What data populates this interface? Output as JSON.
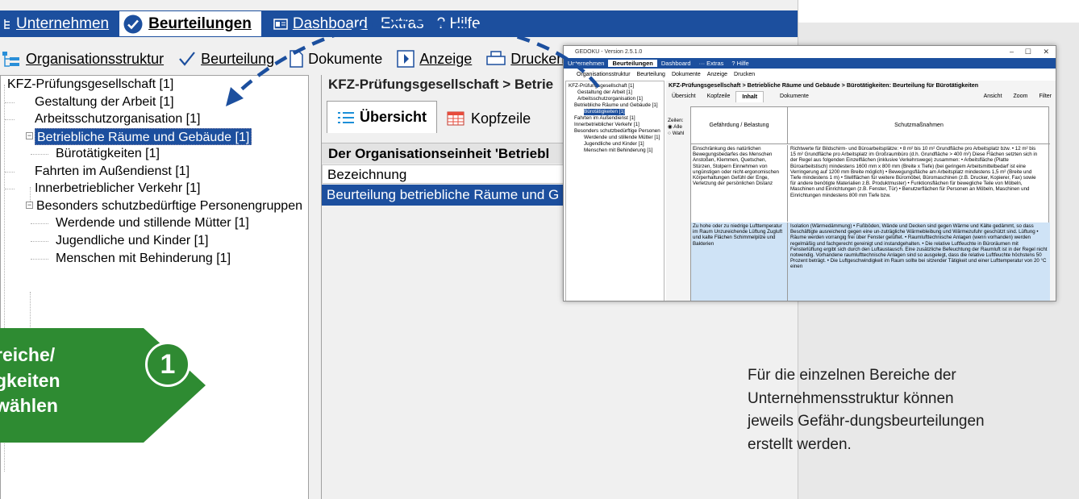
{
  "menubar": {
    "items": [
      {
        "label": "Unternehmen",
        "active": false
      },
      {
        "label": "Beurteilungen",
        "active": true
      },
      {
        "label": "Dashboard",
        "active": false
      },
      {
        "label": "Extras",
        "active": false
      },
      {
        "label": "? Hilfe",
        "active": false
      }
    ]
  },
  "toolbar": {
    "items": [
      "Organisationsstruktur",
      "Beurteilung",
      "Dokumente",
      "Anzeige",
      "Drucken"
    ]
  },
  "tree": {
    "root": "KFZ-Prüfungsgesellschaft [1]",
    "items": [
      "Gestaltung der Arbeit [1]",
      "Arbeitsschutzorganisation [1]",
      "Betriebliche Räume und Gebäude [1]",
      "Bürotätigkeiten [1]",
      "Fahrten im Außendienst [1]",
      "Innerbetrieblicher Verkehr [1]",
      "Besonders schutzbedürftige Personengruppen",
      "Werdende und stillende Mütter [1]",
      "Jugendliche und Kinder [1]",
      "Menschen mit Behinderung [1]"
    ]
  },
  "content": {
    "breadcrumb": "KFZ-Prüfungsgesellschaft > Betrie",
    "tabs": [
      "Übersicht",
      "Kopfzeile"
    ],
    "section_heading": "Der Organisationseinheit 'Betriebl",
    "column_header": "Bezeichnung",
    "row": "Beurteilung betriebliche Räume und G"
  },
  "callout": {
    "lines": [
      "reiche/",
      "gkeiten",
      "wählen"
    ],
    "step": "1",
    "color": "#2e8b32"
  },
  "info_text": "Für die einzelnen Bereiche der Unternehmensstruktur können jeweils Gefähr-dungsbeurteilungen erstellt werden.",
  "screenshot": {
    "title": "GEDOKU - Version 2.5.1.0",
    "menubar": [
      "Unternehmen",
      "Beurteilungen",
      "Dashboard",
      "··· Extras",
      "? Hilfe"
    ],
    "toolbar": [
      "Organisationsstruktur",
      "Beurteilung",
      "Dokumente",
      "Anzeige",
      "Drucken"
    ],
    "tree": [
      "KFZ-Prüfungsgesellschaft [1]",
      "Gestaltung der Arbeit [1]",
      "Arbeitsschutzorganisation [1]",
      "Betriebliche Räume und Gebäude [1]",
      "Bürotätigkeiten [1]",
      "Fahrten im Außendienst [1]",
      "Innerbetrieblicher Verkehr [1]",
      "Besonders schutzbedürftige Personen",
      "Werdende und stillende Mütter [1]",
      "Jugendliche und Kinder [1]",
      "Menschen mit Behinderung [1]"
    ],
    "breadcrumb": "KFZ-Prüfungsgesellschaft > Betriebliche Räume und Gebäude > Bürotätigkeiten: Beurteilung für Bürotätigkeiten",
    "tabs": [
      "Übersicht",
      "Kopfzeile",
      "Inhalt",
      "Dokumente"
    ],
    "tools": [
      "Ansicht",
      "Zoom",
      "Filter"
    ],
    "zeilen_label": "Zeilen:",
    "zeilen_options": [
      "Alle",
      "Wahl"
    ],
    "col_gefaehrdung": "Gefährdung / Belastung",
    "col_schutz": "Schutzmaßnahmen",
    "row1_gef": "Einschränkung des natürlichen Bewegungsbedarfes des Menschen Anstoßen, Klemmen, Quetschen, Stürzen, Stolpern Einnehmen von ungünstigen oder nicht-ergonomischen Körperhaltungen Gefühl der Enge, Verletzung der persönlichen Distanz",
    "row1_sch": "Richtwerte für Bildschirm- und Büroarbeitsplätze: • 8 m² bis 10 m² Grundfläche pro Arbeitsplatz bzw. • 12 m² bis 15 m² Grundfläche pro Arbeitsplatz im Großraumbüro (d.h. Grundfläche > 400 m²) Diese Flächen setzten sich in der Regel aus folgenden Einzelflächen (inklusive Verkehrswege) zusammen: • Arbeitsfläche (Platte Büroarbeitstisch) mindestens 1600 mm x 800 mm (Breite x Tiefe) (bei geringem Arbeitsmittelbedarf ist eine Verringerung auf 1200 mm Breite möglich) • Bewegungsfläche am Arbeitsplatz mindestens 1,5 m² (Breite und Tiefe mindestens 1 m) • Stellflächen für weitere Büromöbel, Büromaschinen (z.B. Drucker, Kopierer, Fax) sowie für andere benötigte Materialien z.B. Produktmuster) • Funktionsflächen für bewegliche Teile von Möbeln, Maschinen und Einrichtungen (z.B. Fenster, Tür) • Benutzerflächen für Personen an Möbeln, Maschinen und Einrichtungen mindestens 800 mm Tiefe bzw.",
    "row2_gef": "Zu hohe oder zu niedrige Lufttemperatur im Raum Unzureichende Lüftung Zugluft und kalte Flächen Schimmelpilze und Bakterien",
    "row2_sch": "Isolation (Wärmedämmung) • Fußböden, Wände und Decken sind gegen Wärme und Kälte gedämmt, so dass Beschäftigte ausreichend gegen eine un-zuträgliche Wärmebleibung und Wärmezufuhr geschützt sind. Lüftung • Räume werden vorrangig frei über Fenster gelüftet. • Raumlufttechnische Anlagen (wenn vorhanden) werden regelmäßig und fachgerecht gereinigt und instandgehalten. • Die relative Luftfeuchte in Büroräumen mit Fensterlüftung ergibt sich durch den Luftaustausch. Eine zusätzliche Befeuchtung der Raumluft ist in der Regel nicht notwendig. Vorhandene raumlufttechnische Anlagen sind so ausgelegt, dass die relative Luftfeuchte höchstens 50 Prozent beträgt. • Die Luftgeschwindigkeit im Raum sollte bei sitzender Tätigkeit und einer Lufttemperatur von 20 °C einen"
  },
  "colors": {
    "menubar_blue": "#1c4f9e",
    "selection_blue": "#1c4f9e",
    "row_highlight": "#cfe3f6"
  }
}
